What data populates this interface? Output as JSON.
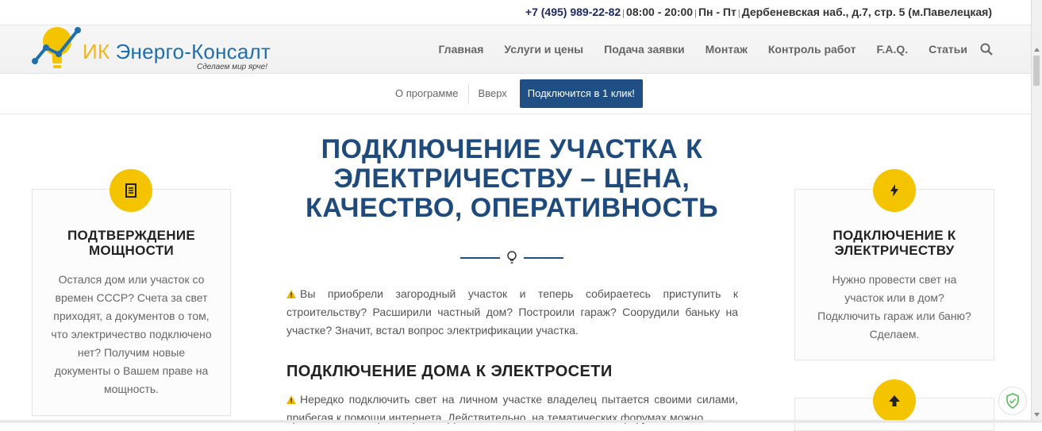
{
  "topbar": {
    "phone": "+7 (495) 989-22-82",
    "hours": "08:00 - 20:00",
    "days": "Пн - Пт",
    "address": "Дербеневская наб., д.7, стр. 5 (м.Павелецкая)",
    "separator": "|"
  },
  "header": {
    "logo_prefix": "ИК",
    "logo_name": "Энерго-Консалт",
    "slogan": "Сделаем мир ярче!",
    "nav": [
      "Главная",
      "Услуги и цены",
      "Подача заявки",
      "Монтаж",
      "Контроль работ",
      "F.A.Q.",
      "Статьи"
    ],
    "search_icon": "search-icon"
  },
  "subnav": {
    "about": "О программе",
    "top": "Вверх",
    "connect_button": "Подключится в 1 клик!"
  },
  "left_card": {
    "icon": "document-icon",
    "title": "ПОДТВЕРЖДЕНИЕ МОЩНОСТИ",
    "text": "Остался дом или участок со времен СССР? Счета за свет приходят, а документов о том, что электричество подключено нет? Получим новые документы о Вашем праве на мощность."
  },
  "right_card": {
    "icon": "lightning-icon",
    "title": "ПОДКЛЮЧЕНИЕ К ЭЛЕКТРИЧЕСТВУ",
    "text": "Нужно провести свет на участок или в дом? Подключить гараж или баню? Сделаем."
  },
  "right_card_2": {
    "icon": "arrow-up-icon"
  },
  "main": {
    "title": "ПОДКЛЮЧЕНИЕ УЧАСТКА К ЭЛЕКТРИЧЕСТВУ – ЦЕНА, КАЧЕСТВО, ОПЕРАТИВНОСТЬ",
    "divider_icon": "lightbulb-icon",
    "para1": "Вы приобрели загородный участок и теперь собираетесь приступить к строительству? Расширили частный дом? Построили гараж? Соорудили баньку на участке? Значит, встал вопрос электрификации участка.",
    "h2": "ПОДКЛЮЧЕНИЕ ДОМА К ЭЛЕКТРОСЕТИ",
    "para2": "Нередко подключить свет на личном участке владелец пытается своими силами, прибегая к помощи интернета. Действительно, на тематических форумах можно"
  },
  "colors": {
    "accent": "#f5c400",
    "brand_blue": "#1f4f84",
    "title_blue": "#1f4a7c"
  }
}
